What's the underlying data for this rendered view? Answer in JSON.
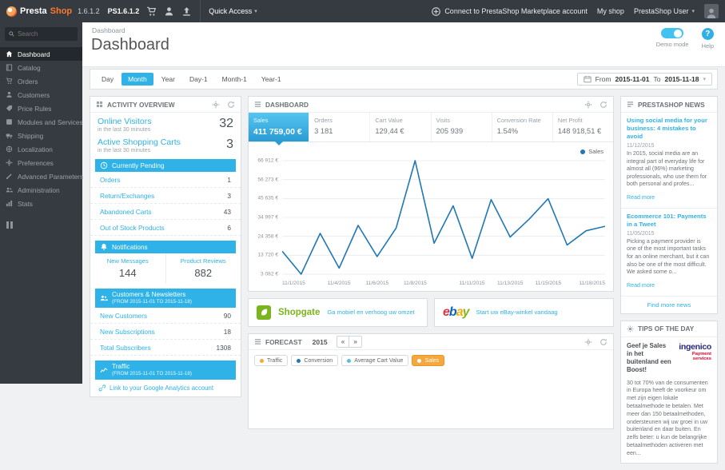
{
  "topbar": {
    "brand_presta": "Presta",
    "brand_shop": "Shop",
    "version": "1.6.1.2",
    "shop_name": "PS1.6.1.2",
    "quick_access": "Quick Access",
    "marketplace_link": "Connect to PrestaShop Marketplace account",
    "my_shop": "My shop",
    "user_name": "PrestaShop User"
  },
  "sidebar": {
    "search_placeholder": "Search",
    "items": [
      {
        "label": "Dashboard"
      },
      {
        "label": "Catalog"
      },
      {
        "label": "Orders"
      },
      {
        "label": "Customers"
      },
      {
        "label": "Price Rules"
      },
      {
        "label": "Modules and Services"
      },
      {
        "label": "Shipping"
      },
      {
        "label": "Localization"
      },
      {
        "label": "Preferences"
      },
      {
        "label": "Advanced Parameters"
      },
      {
        "label": "Administration"
      },
      {
        "label": "Stats"
      }
    ]
  },
  "header": {
    "breadcrumb": "Dashboard",
    "title": "Dashboard",
    "demo_mode_label": "Demo mode",
    "help_label": "Help"
  },
  "toolbar": {
    "range_buttons": [
      "Day",
      "Month",
      "Year",
      "Day-1",
      "Month-1",
      "Year-1"
    ],
    "active_button": "Month",
    "from_label": "From",
    "from_date": "2015-11-01",
    "to_label": "To",
    "to_date": "2015-11-18"
  },
  "activity": {
    "title": "ACTIVITY OVERVIEW",
    "online_visitors": {
      "label": "Online Visitors",
      "sub": "in the last 30 minutes",
      "value": "32"
    },
    "shopping_carts": {
      "label": "Active Shopping Carts",
      "sub": "in the last 30 minutes",
      "value": "3"
    },
    "pending": {
      "title": "Currently Pending",
      "rows": [
        {
          "label": "Orders",
          "value": "1"
        },
        {
          "label": "Return/Exchanges",
          "value": "3"
        },
        {
          "label": "Abandoned Carts",
          "value": "43"
        },
        {
          "label": "Out of Stock Products",
          "value": "6"
        }
      ]
    },
    "notifications": {
      "title": "Notifications",
      "cells": [
        {
          "label": "New Messages",
          "value": "144"
        },
        {
          "label": "Product Reviews",
          "value": "882"
        }
      ]
    },
    "customers": {
      "title": "Customers & Newsletters",
      "sub": "(FROM 2015-11-01 TO 2015-11-18)",
      "rows": [
        {
          "label": "New Customers",
          "value": "90"
        },
        {
          "label": "New Subscriptions",
          "value": "18"
        },
        {
          "label": "Total Subscribers",
          "value": "1308"
        }
      ]
    },
    "traffic": {
      "title": "Traffic",
      "sub": "(FROM 2015-11-01 TO 2015-11-18)",
      "link": "Link to your Google Analytics account"
    }
  },
  "dashboard": {
    "title": "DASHBOARD",
    "kpis": [
      {
        "label": "Sales",
        "value": "411 759,00 €"
      },
      {
        "label": "Orders",
        "value": "3 181"
      },
      {
        "label": "Cart Value",
        "value": "129,44 €"
      },
      {
        "label": "Visits",
        "value": "205 939"
      },
      {
        "label": "Conversion Rate",
        "value": "1.54%"
      },
      {
        "label": "Net Profit",
        "value": "148 918,51 €"
      }
    ],
    "legend_label": "Sales"
  },
  "chart_data": {
    "type": "line",
    "title": "Sales",
    "x": [
      "11/1/2015",
      "11/2/2015",
      "11/3/2015",
      "11/4/2015",
      "11/5/2015",
      "11/6/2015",
      "11/7/2015",
      "11/8/2015",
      "11/9/2015",
      "11/10/2015",
      "11/11/2015",
      "11/12/2015",
      "11/13/2015",
      "11/14/2015",
      "11/15/2015",
      "11/16/2015",
      "11/17/2015",
      "11/18/2015"
    ],
    "series": [
      {
        "name": "Sales",
        "values": [
          16000,
          3082,
          26000,
          6500,
          30500,
          13000,
          29000,
          66912,
          20500,
          41500,
          12000,
          45000,
          24000,
          34000,
          45500,
          19500,
          27500,
          30000
        ]
      }
    ],
    "ylim": [
      3082,
      66912
    ],
    "y_ticks": [
      "66 912 €",
      "56 273 €",
      "45 635 €",
      "34 997 €",
      "24 358 €",
      "13 720 €",
      "3 082 €"
    ],
    "x_ticks": [
      "11/1/2015",
      "11/4/2015",
      "11/6/2015",
      "11/8/2015",
      "11/11/2015",
      "11/13/2015",
      "11/15/2015",
      "11/18/2015"
    ],
    "line_color": "#1f77b4",
    "grid": true,
    "legend_position": "top-right"
  },
  "modules": {
    "shopgate": {
      "brand": "Shopgate",
      "link": "Ga mobiel en verhoog uw omzet"
    },
    "ebay": {
      "letters": [
        "e",
        "b",
        "a",
        "y"
      ],
      "link": "Start uw eBay-winkel vandaag"
    }
  },
  "forecast": {
    "title": "FORECAST",
    "year": "2015",
    "prev": "«",
    "next": "»",
    "legend": [
      {
        "label": "Traffic",
        "color": "#f5a83b"
      },
      {
        "label": "Conversion",
        "color": "#1f77b4"
      },
      {
        "label": "Average Cart Value",
        "color": "#5bc0de"
      },
      {
        "label": "Sales",
        "color": "#ffffff"
      }
    ],
    "active_legend": "Sales"
  },
  "news": {
    "title": "PRESTASHOP NEWS",
    "items": [
      {
        "headline": "Using social media for your business: 4 mistakes to avoid",
        "date": "11/12/2015",
        "excerpt": "In 2015, social media are an integral part of everyday life for almost all (96%) marketing professionals, who use them for both personal and profes...",
        "read_more": "Read more"
      },
      {
        "headline": "Ecommerce 101: Payments in a Tweet",
        "date": "11/05/2015",
        "excerpt": "Picking a payment provider is one of the most important tasks for an online merchant, but it can also be one of the most difficult. We asked some o...",
        "read_more": "Read more"
      }
    ],
    "more_link": "Find more news"
  },
  "tips": {
    "title": "TIPS OF THE DAY",
    "headline": "Geef je Sales in het buitenland een Boost!",
    "brand": "ingenico",
    "brand_tagline": "Payment services",
    "body": "30 tot 70% van de consumenten in Europa heeft de voorkeur om met zijn eigen lokale betaalmethode te betalen. Met meer dan 150 betaalmethoden, ondersteunen wij uw groei in uw buitenland en daar buiten. En zelfs beter: u kun de belangrijke betaalmethoden activeren met een..."
  }
}
